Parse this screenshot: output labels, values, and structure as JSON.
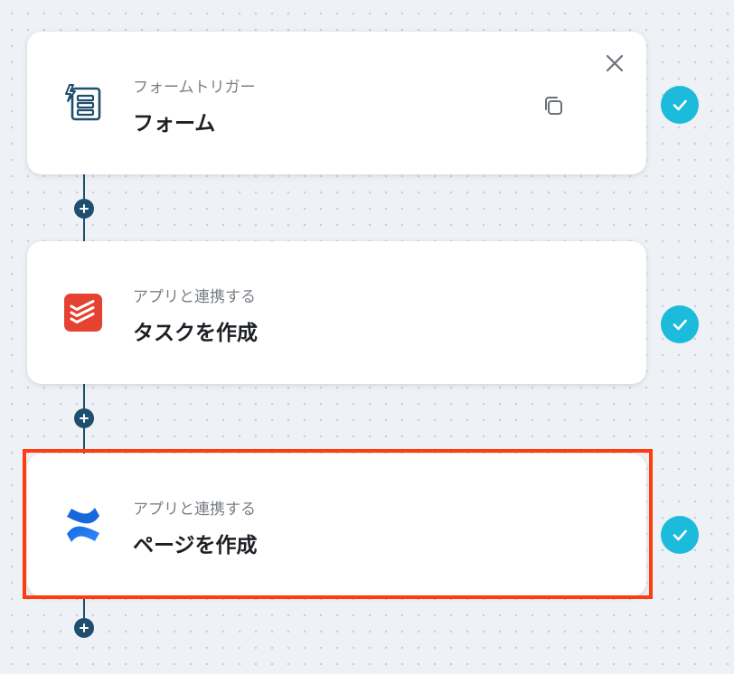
{
  "colors": {
    "connector": "#1f4e6e",
    "check": "#1dbbdb",
    "highlight": "#ff3b0f",
    "todoist": "#e44332",
    "confluence": "#1868db",
    "form_icon": "#1f4e6e"
  },
  "flow": {
    "steps": [
      {
        "subtitle": "フォームトリガー",
        "title": "フォーム",
        "icon": "form-trigger-icon",
        "status": "completed",
        "actions": [
          "copy-icon",
          "close-icon"
        ]
      },
      {
        "subtitle": "アプリと連携する",
        "title": "タスクを作成",
        "icon": "todoist-icon",
        "status": "completed"
      },
      {
        "subtitle": "アプリと連携する",
        "title": "ページを作成",
        "icon": "confluence-icon",
        "status": "completed",
        "highlighted": true
      }
    ],
    "add_step_icon": "plus-icon"
  }
}
